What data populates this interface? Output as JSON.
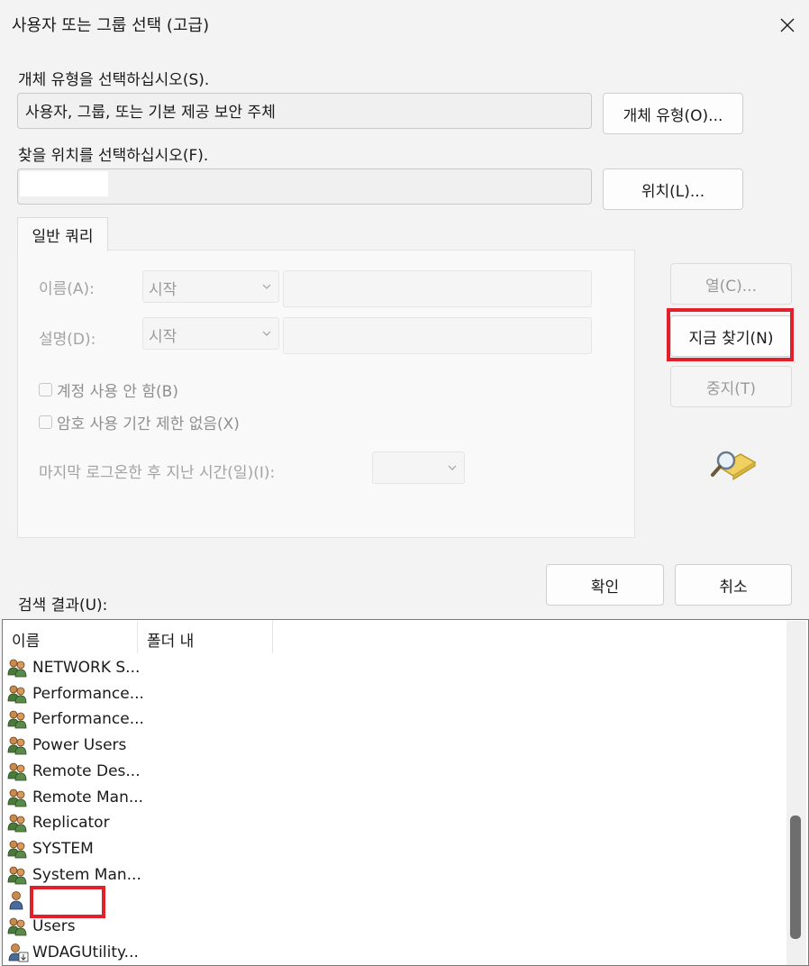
{
  "window": {
    "title": "사용자 또는 그룹 선택 (고급)"
  },
  "object_type": {
    "label": "개체 유형을 선택하십시오(S).",
    "value": "사용자, 그룹, 또는 기본 제공 보안 주체",
    "button": "개체 유형(O)..."
  },
  "location": {
    "label": "찾을 위치를 선택하십시오(F).",
    "value": "",
    "button": "위치(L)..."
  },
  "query": {
    "tab_label": "일반 쿼리",
    "name_label": "이름(A):",
    "name_mode": "시작",
    "desc_label": "설명(D):",
    "desc_mode": "시작",
    "disabled_accounts": "계정 사용 안 함(B)",
    "non_expiring_password": "암호 사용 기간 제한 없음(X)",
    "days_since_logon": "마지막 로그온한 후 지난 시간(일)(I):",
    "columns_button": "열(C)...",
    "find_now_button": "지금 찾기(N)",
    "stop_button": "중지(T)"
  },
  "dialog_buttons": {
    "ok": "확인",
    "cancel": "취소"
  },
  "results": {
    "label": "검색 결과(U):",
    "columns": [
      "이름",
      "폴더 내"
    ],
    "rows": [
      {
        "name": "NETWORK S...",
        "icon": "group-icon"
      },
      {
        "name": "Performance...",
        "icon": "group-icon"
      },
      {
        "name": "Performance...",
        "icon": "group-icon"
      },
      {
        "name": "Power Users",
        "icon": "group-icon"
      },
      {
        "name": "Remote Des...",
        "icon": "group-icon"
      },
      {
        "name": "Remote Man...",
        "icon": "group-icon"
      },
      {
        "name": "Replicator",
        "icon": "group-icon"
      },
      {
        "name": "SYSTEM",
        "icon": "group-icon"
      },
      {
        "name": "System Man...",
        "icon": "group-icon"
      },
      {
        "name": "",
        "icon": "user-icon"
      },
      {
        "name": "Users",
        "icon": "group-icon"
      },
      {
        "name": "WDAGUtility...",
        "icon": "user-download-icon"
      }
    ]
  },
  "colors": {
    "highlight": "#e0202a",
    "background": "#f3f3f3"
  }
}
